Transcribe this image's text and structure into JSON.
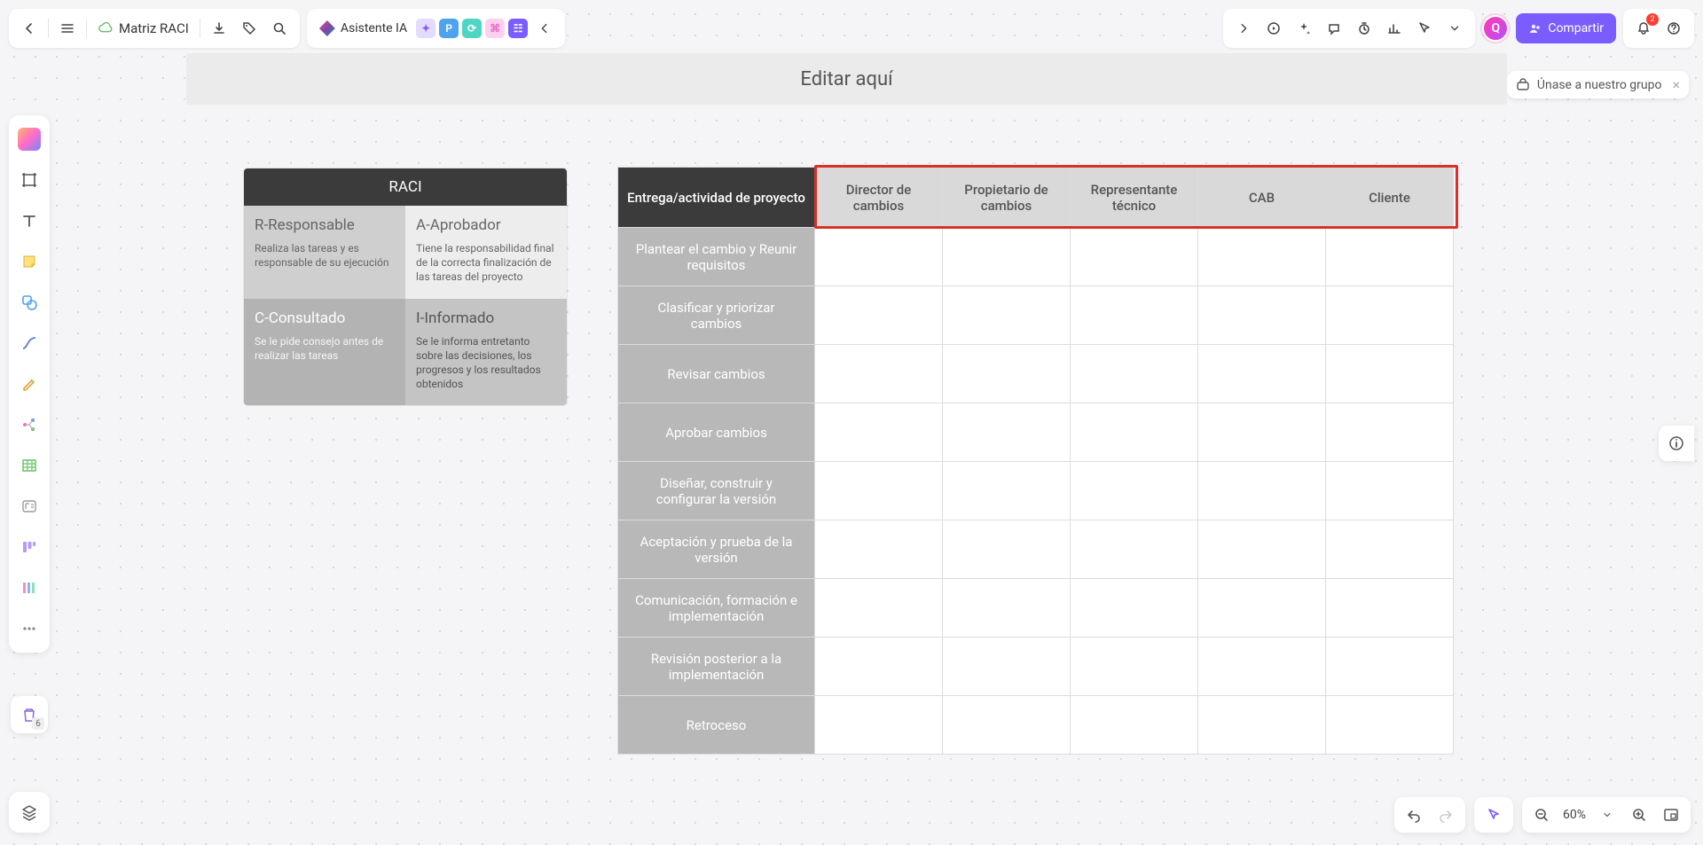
{
  "header": {
    "doc_title": "Matriz RACI",
    "ai_label": "Asistente IA",
    "share_label": "Compartir",
    "avatar_initial": "Q",
    "notif_count": "2",
    "zoom_label": "60%"
  },
  "join_chip": {
    "label": "Únase a nuestro grupo"
  },
  "banner": {
    "text": "Editar aquí"
  },
  "raci_quad": {
    "title": "RACI",
    "cells": {
      "r": {
        "title": "R-Responsable",
        "desc": "Realiza las tareas y es responsable de su ejecución"
      },
      "a": {
        "title": "A-Aprobador",
        "desc": "Tiene la responsabilidad final de la correcta finalización de las tareas del proyecto"
      },
      "c": {
        "title": "C-Consultado",
        "desc": "Se le pide consejo antes de realizar las tareas"
      },
      "i": {
        "title": "I-Informado",
        "desc": "Se le informa entretanto sobre las decisiones, los progresos y los resultados obtenidos"
      }
    }
  },
  "matrix": {
    "corner": "Entrega/actividad de proyecto",
    "cols": [
      "Director de cambios",
      "Propietario de cambios",
      "Representante técnico",
      "CAB",
      "Cliente"
    ],
    "rows": [
      "Plantear el cambio y Reunir requisitos",
      "Clasificar y priorizar cambios",
      "Revisar cambios",
      "Aprobar cambios",
      "Diseñar, construir y configurar la versión",
      "Aceptación y prueba de la versión",
      "Comunicación, formación e implementación",
      "Revisión posterior a la implementación",
      "Retroceso"
    ]
  },
  "trash_badge": "6"
}
